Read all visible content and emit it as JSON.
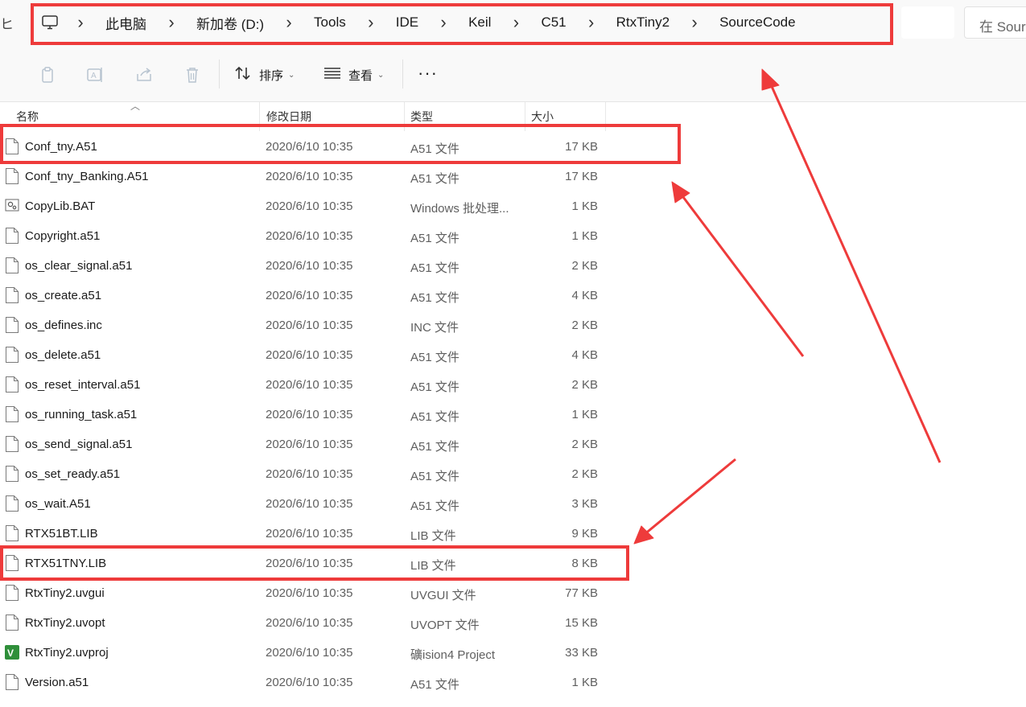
{
  "address_bar": {
    "left_fragment": "ヒ",
    "breadcrumbs": [
      "此电脑",
      "新加卷 (D:)",
      "Tools",
      "IDE",
      "Keil",
      "C51",
      "RtxTiny2",
      "SourceCode"
    ],
    "search_placeholder": "在 SourceCode 中搜索"
  },
  "toolbar": {
    "sort_label": "排序",
    "view_label": "查看",
    "more_label": "···"
  },
  "columns": {
    "name": "名称",
    "modified": "修改日期",
    "type": "类型",
    "size": "大小"
  },
  "files": [
    {
      "name": "Conf_tny.A51",
      "date": "2020/6/10 10:35",
      "type": "A51 文件",
      "size": "17 KB",
      "icon": "file-icon"
    },
    {
      "name": "Conf_tny_Banking.A51",
      "date": "2020/6/10 10:35",
      "type": "A51 文件",
      "size": "17 KB",
      "icon": "file-icon"
    },
    {
      "name": "CopyLib.BAT",
      "date": "2020/6/10 10:35",
      "type": "Windows 批处理...",
      "size": "1 KB",
      "icon": "batch-file-icon"
    },
    {
      "name": "Copyright.a51",
      "date": "2020/6/10 10:35",
      "type": "A51 文件",
      "size": "1 KB",
      "icon": "file-icon"
    },
    {
      "name": "os_clear_signal.a51",
      "date": "2020/6/10 10:35",
      "type": "A51 文件",
      "size": "2 KB",
      "icon": "file-icon"
    },
    {
      "name": "os_create.a51",
      "date": "2020/6/10 10:35",
      "type": "A51 文件",
      "size": "4 KB",
      "icon": "file-icon"
    },
    {
      "name": "os_defines.inc",
      "date": "2020/6/10 10:35",
      "type": "INC 文件",
      "size": "2 KB",
      "icon": "file-icon"
    },
    {
      "name": "os_delete.a51",
      "date": "2020/6/10 10:35",
      "type": "A51 文件",
      "size": "4 KB",
      "icon": "file-icon"
    },
    {
      "name": "os_reset_interval.a51",
      "date": "2020/6/10 10:35",
      "type": "A51 文件",
      "size": "2 KB",
      "icon": "file-icon"
    },
    {
      "name": "os_running_task.a51",
      "date": "2020/6/10 10:35",
      "type": "A51 文件",
      "size": "1 KB",
      "icon": "file-icon"
    },
    {
      "name": "os_send_signal.a51",
      "date": "2020/6/10 10:35",
      "type": "A51 文件",
      "size": "2 KB",
      "icon": "file-icon"
    },
    {
      "name": "os_set_ready.a51",
      "date": "2020/6/10 10:35",
      "type": "A51 文件",
      "size": "2 KB",
      "icon": "file-icon"
    },
    {
      "name": "os_wait.A51",
      "date": "2020/6/10 10:35",
      "type": "A51 文件",
      "size": "3 KB",
      "icon": "file-icon"
    },
    {
      "name": "RTX51BT.LIB",
      "date": "2020/6/10 10:35",
      "type": "LIB 文件",
      "size": "9 KB",
      "icon": "file-icon"
    },
    {
      "name": "RTX51TNY.LIB",
      "date": "2020/6/10 10:35",
      "type": "LIB 文件",
      "size": "8 KB",
      "icon": "file-icon"
    },
    {
      "name": "RtxTiny2.uvgui",
      "date": "2020/6/10 10:35",
      "type": "UVGUI 文件",
      "size": "77 KB",
      "icon": "file-icon"
    },
    {
      "name": "RtxTiny2.uvopt",
      "date": "2020/6/10 10:35",
      "type": "UVOPT 文件",
      "size": "15 KB",
      "icon": "file-icon"
    },
    {
      "name": "RtxTiny2.uvproj",
      "date": "2020/6/10 10:35",
      "type": "礦ision4 Project",
      "size": "33 KB",
      "icon": "keil-project-icon"
    },
    {
      "name": "Version.a51",
      "date": "2020/6/10 10:35",
      "type": "A51 文件",
      "size": "1 KB",
      "icon": "file-icon"
    }
  ],
  "annotation_color": "#ee3b3b"
}
